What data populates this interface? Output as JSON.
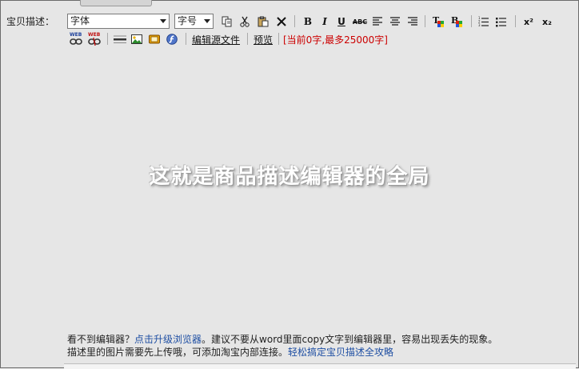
{
  "form": {
    "label": "宝贝描述："
  },
  "toolbar": {
    "font_select": "字体",
    "size_select": "字号",
    "bold": "B",
    "italic": "I",
    "underline": "U",
    "strike": "ABC",
    "superscript": "x²",
    "subscript": "x₂",
    "web_badge": "WEB",
    "source_link": "编辑源文件",
    "preview_link": "预览",
    "char_count": "[当前0字,最多25000字]"
  },
  "editor": {
    "watermark": "这就是商品描述编辑器的全局"
  },
  "help": {
    "line1_prefix": "看不到编辑器？",
    "line1_link": "点击升级浏览器",
    "line1_suffix": "。建议不要从word里面copy文字到编辑器里，容易出现丢失的现象。",
    "line2_prefix": "描述里的图片需要先上传哦，可添加淘宝内部连接。",
    "line2_link": "轻松搞定宝贝描述全攻略"
  },
  "colors": {
    "background": "#e6e6e6",
    "link_blue": "#1f4fa3",
    "count_red": "#cc0000"
  }
}
